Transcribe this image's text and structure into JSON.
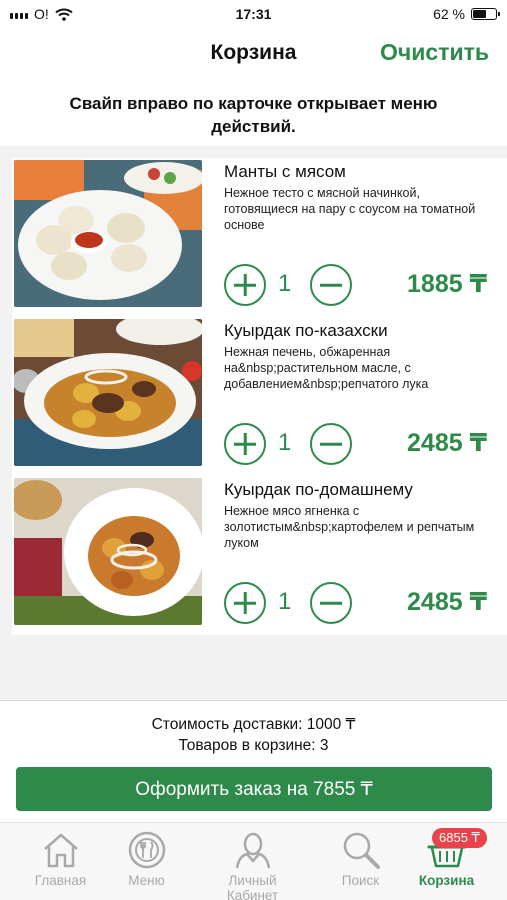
{
  "status_bar": {
    "carrier": "O!",
    "time": "17:31",
    "battery": "62 %",
    "battery_level": 0.62
  },
  "header": {
    "title": "Корзина",
    "clear_label": "Очистить"
  },
  "hint": "Свайп вправо по карточке открывает меню действий.",
  "items": [
    {
      "name": "Манты с мясом",
      "description": "Нежное тесто с мясной начинкой, готовящиеся на пару с соусом на томатной основе",
      "quantity": "1",
      "price": "1885 ₸",
      "image_icon": "manty-dish-image"
    },
    {
      "name": "Куырдак по-казахски",
      "description": "Нежная печень, обжаренная на&nbsp;растительном масле, с добавлением&nbsp;репчатого лука",
      "quantity": "1",
      "price": "2485 ₸",
      "image_icon": "kuyrdak-kazakh-dish-image"
    },
    {
      "name": "Куырдак по-домашнему",
      "description": "Нежное мясо ягненка с золотистым&nbsp;картофелем и репчатым луком",
      "quantity": "1",
      "price": "2485 ₸",
      "image_icon": "kuyrdak-home-dish-image"
    }
  ],
  "summary": {
    "delivery": "Стоимость доставки: 1000 ₸",
    "count": "Товаров в корзине: 3",
    "order_label": "Оформить заказ на 7855 ₸"
  },
  "tabs": [
    {
      "label": "Главная",
      "icon": "home-icon"
    },
    {
      "label": "Меню",
      "icon": "dish-icon"
    },
    {
      "label": "Личный Кабинет",
      "icon": "user-icon"
    },
    {
      "label": "Поиск",
      "icon": "search-icon"
    },
    {
      "label": "Корзина",
      "icon": "basket-icon",
      "badge": "6855 ₸",
      "active": true
    }
  ],
  "colors": {
    "accent": "#2e8a4a",
    "badge": "#e8434a",
    "inactive_tab": "#a9a9a9"
  }
}
